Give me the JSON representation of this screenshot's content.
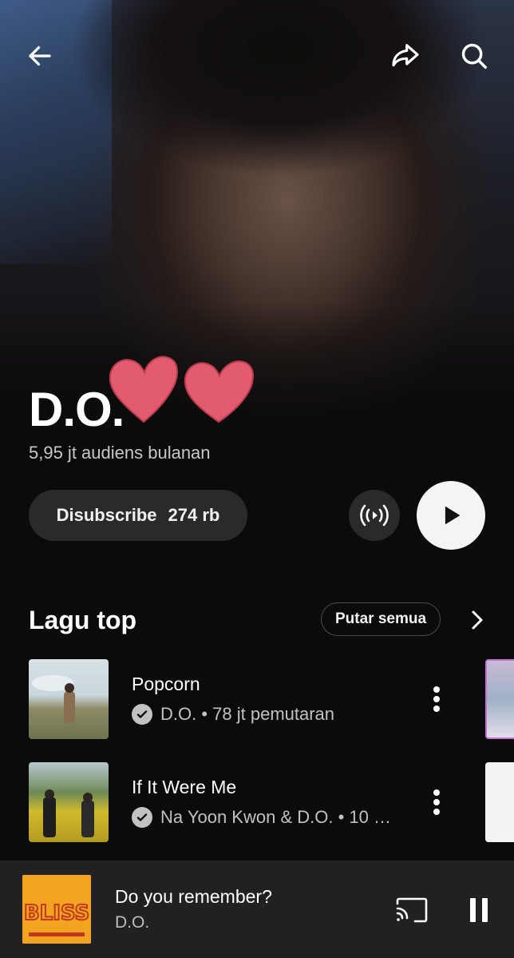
{
  "header": {
    "back_icon": "arrow-left-icon",
    "share_icon": "share-icon",
    "search_icon": "search-icon"
  },
  "artist": {
    "name": "D.O.",
    "monthly_listeners": "5,95 jt audiens bulanan",
    "decoration_icon": "hearts-sticker"
  },
  "actions": {
    "subscribe_label": "Disubscribe",
    "subscriber_count": "274 rb",
    "radio_icon": "radio-broadcast-icon",
    "play_icon": "play-icon"
  },
  "top_songs": {
    "title": "Lagu top",
    "play_all_label": "Putar semua",
    "more_icon": "chevron-right-icon",
    "items": [
      {
        "title": "Popcorn",
        "meta": "D.O. • 78 jt pemutaran",
        "verified_icon": "check-circle-icon",
        "menu_icon": "more-vertical-icon"
      },
      {
        "title": "If It Were Me",
        "meta": "Na Yoon Kwon & D.O. • 10 …",
        "verified_icon": "check-circle-icon",
        "menu_icon": "more-vertical-icon"
      }
    ]
  },
  "now_playing": {
    "title": "Do you remember?",
    "artist": "D.O.",
    "art_text": "BLISS",
    "cast_icon": "cast-icon",
    "pause_icon": "pause-icon"
  },
  "colors": {
    "background": "#0b0b0b",
    "surface": "#2a2a2a",
    "mini_player": "#212121",
    "heart": "#e25b6e",
    "album_art": "#f2a421"
  }
}
